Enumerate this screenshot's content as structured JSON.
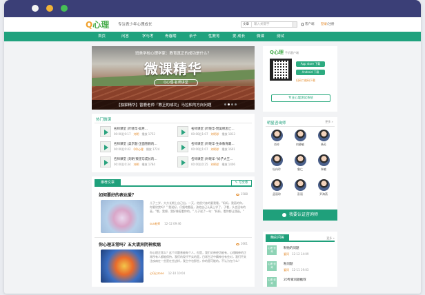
{
  "site": {
    "logo_q": "Q",
    "logo_text": "心理",
    "slogan": "专注青少年心理成长",
    "search_select": "文章",
    "search_placeholder": "输入关键字",
    "app_label": "客户端",
    "login": "登录",
    "register": "/注册"
  },
  "nav": [
    "首页",
    "问答",
    "学与考",
    "青春期",
    "亲子",
    "性教育",
    "爱·成长",
    "微课",
    "测试"
  ],
  "banner": {
    "question": "班美学校心理学家：教育真正的成功是什么？",
    "title": "微课精华",
    "pill": "Q心理·名师讲堂",
    "caption": "【独家精华】曾鹿老师「教正的成功」马拉松的方向问题"
  },
  "micro": {
    "heading": "热门微课",
    "items": [
      {
        "title": "名师课堂 |叶晓华·如月...",
        "date": "00:00后0:17",
        "author": "刘明",
        "plays_label": "播放",
        "plays": "1752"
      },
      {
        "title": "名师课堂 |叶晓华·赞美积思亡...",
        "date": "00:00后1:07",
        "author": "刘明珍",
        "plays_label": "播放",
        "plays": "1813"
      },
      {
        "title": "名师课堂 |美京题·正面管教的...",
        "date": "00:00后0:42",
        "author": "QQ心理",
        "plays_label": "播放",
        "plays": "1724"
      },
      {
        "title": "名师课堂 |叶晓华·生命教育最...",
        "date": "00:00后1:07",
        "author": "刘明珍",
        "plays_label": "播放",
        "plays": "1691"
      },
      {
        "title": "名师课堂 |刘明·叛逆与成长的...",
        "date": "00:00后0:34",
        "author": "刘明",
        "plays_label": "播放",
        "plays": "1784"
      },
      {
        "title": "名师课堂 |叶晓华·\"妈子大王...",
        "date": "00:00后0:25",
        "author": "刘明珍",
        "plays_label": "播放",
        "plays": "1406"
      }
    ]
  },
  "articles": {
    "tab": "推荐文章",
    "write_btn": "写文章",
    "items": [
      {
        "title": "如何要好的表达爱？",
        "excerpt": "儿子三岁，大方长期上自己出。一天，他很兴奋的要我看，\"妈妈，我画的你，你要欣赏吗？\"  我说好。仔细地看画，孩他自己认真上学了，子看，头也没有的画，\"哦，我想，我好像挺看你的。\" 儿子说了一句：\"妈妈，看你都让我画。\"",
        "author": "sun老师",
        "date": "12-12 09:46",
        "views": "1588"
      },
      {
        "title": "你心理正常吗？五大请异阴神疾病",
        "excerpt": "你心理正常么？这个问题曾被每个人，但是，我们对神经功能有，心理精神的正常所有人都能保持，我们的现代平实的是，日常生活中精神也有些对，我们不关注疾病在一些是在些这样，我主中也那些，你的是可能的。不认为在什么？",
        "author": "心Q心zone",
        "date": "12-10 10:04",
        "views": "1661"
      }
    ]
  },
  "qrpanel": {
    "logo": "Q心理",
    "sub": "手机客户端",
    "ios": "App store 下载",
    "android": "Android 下载",
    "wechat": "扫码二维码下载",
    "cta": "专业心理测试系统"
  },
  "teachers": {
    "heading": "明星咨询师",
    "more": "更多 »",
    "items": [
      {
        "name": "肖岭"
      },
      {
        "name": "何静敏"
      },
      {
        "name": "杨芳"
      },
      {
        "name": "杜伟玲"
      },
      {
        "name": "鲁仁"
      },
      {
        "name": "朱敏"
      },
      {
        "name": "孟丽琼"
      },
      {
        "name": "彭丽"
      },
      {
        "name": "尹海燕"
      }
    ],
    "cert_btn": "我要认证咨询师"
  },
  "qa": {
    "tab": "精彩问答",
    "more": "更多 »",
    "items": [
      {
        "icon_text": "心理 咨询",
        "title": "制他的问题",
        "author": "爱问",
        "date": "12-12 14:09"
      },
      {
        "icon_text": "心理 咨询",
        "title": "啦问题",
        "author": "爱问",
        "date": "12-11 19:03"
      },
      {
        "icon_text": "心理 咨询",
        "title": "20专家问题推荐",
        "author": "",
        "date": ""
      }
    ]
  },
  "colors": {
    "brand": "#1fa07b",
    "accent": "#e2841f",
    "titlebar": "#3b3f77",
    "logo": "#4bae4f"
  }
}
